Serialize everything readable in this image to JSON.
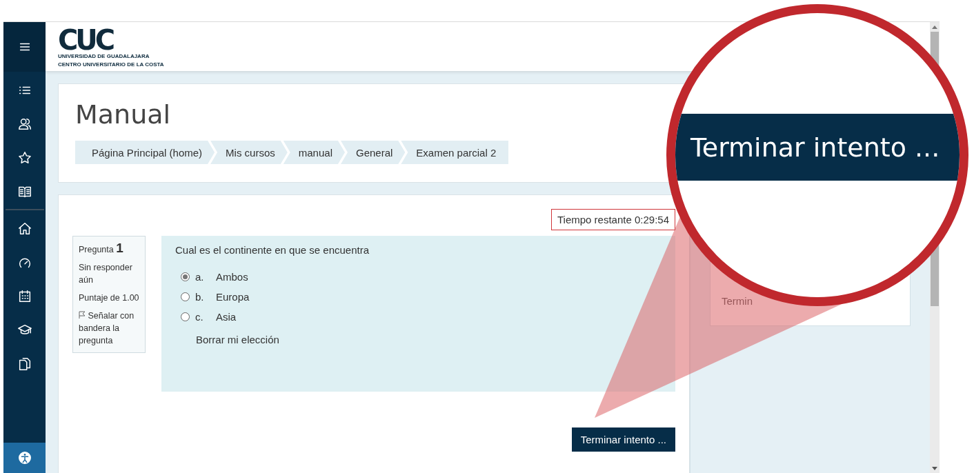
{
  "logo": {
    "letters": "CUC",
    "top_line": "UNIVERSIDAD DE GUADALAJARA",
    "bottom_line": "CENTRO UNIVERSITARIO DE LA COSTA"
  },
  "page_title": "Manual",
  "breadcrumb": [
    "Página Principal (home)",
    "Mis cursos",
    "manual",
    "General",
    "Examen parcial 2"
  ],
  "timer": "Tiempo restante 0:29:54",
  "question_info": {
    "label": "Pregunta",
    "number": "1",
    "status": "Sin responder aún",
    "mark": "Puntaje de 1.00",
    "flag": "Señalar con bandera la pregunta"
  },
  "question": {
    "text": "Cual es el continente en que se encuentra",
    "options": [
      {
        "letter": "a.",
        "text": "Ambos",
        "selected": true
      },
      {
        "letter": "b.",
        "text": "Europa",
        "selected": false
      },
      {
        "letter": "c.",
        "text": "Asia",
        "selected": false
      }
    ],
    "clear": "Borrar mi elección"
  },
  "finish_button": "Terminar intento ...",
  "side_block": {
    "text": "Termin"
  },
  "magnifier": {
    "text": "Terminar intento ..."
  }
}
